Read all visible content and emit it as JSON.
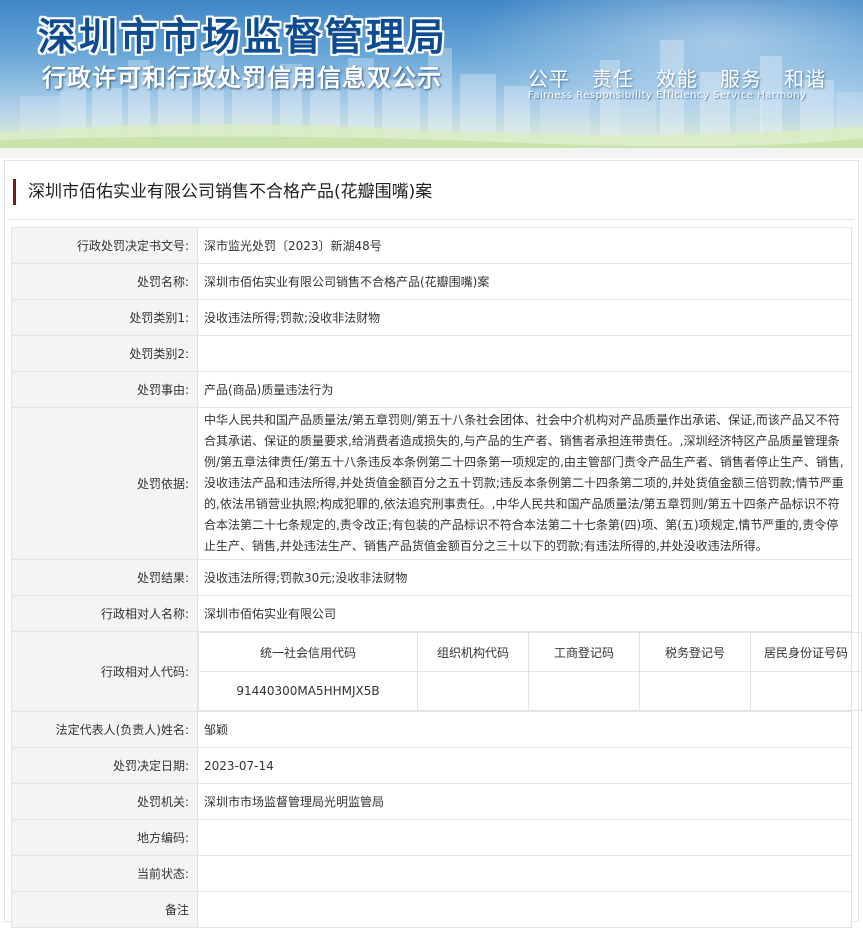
{
  "banner": {
    "title": "深圳市市场监督管理局",
    "subtitle": "行政许可和行政处罚信用信息双公示",
    "slogan": [
      "公平",
      "责任",
      "效能",
      "服务",
      "和谐"
    ],
    "slogan_en": "Fairness Responsibility Efficiency Service Harmony"
  },
  "page": {
    "title": "深圳市佰佑实业有限公司销售不合格产品(花瓣围嘴)案"
  },
  "fields": {
    "doc_no": {
      "label": "行政处罚决定书文号:",
      "value": "深市监光处罚〔2023〕新湖48号"
    },
    "case_name": {
      "label": "处罚名称:",
      "value": "深圳市佰佑实业有限公司销售不合格产品(花瓣围嘴)案"
    },
    "category1": {
      "label": "处罚类别1:",
      "value": "没收违法所得;罚款;没收非法财物"
    },
    "category2": {
      "label": "处罚类别2:",
      "value": ""
    },
    "reason": {
      "label": "处罚事由:",
      "value": "产品(商品)质量违法行为"
    },
    "basis": {
      "label": "处罚依据:",
      "value": "中华人民共和国产品质量法/第五章罚则/第五十八条社会团体、社会中介机构对产品质量作出承诺、保证,而该产品又不符合其承诺、保证的质量要求,给消费者造成损失的,与产品的生产者、销售者承担连带责任。,深圳经济特区产品质量管理条例/第五章法律责任/第五十八条违反本条例第二十四条第一项规定的,由主管部门责令产品生产者、销售者停止生产、销售,没收违法产品和违法所得,并处货值金额百分之五十罚款;违反本条例第二十四条第二项的,并处货值金额三倍罚款;情节严重的,依法吊销营业执照;构成犯罪的,依法追究刑事责任。,中华人民共和国产品质量法/第五章罚则/第五十四条产品标识不符合本法第二十七条规定的,责令改正;有包装的产品标识不符合本法第二十七条第(四)项、第(五)项规定,情节严重的,责令停止生产、销售,并处违法生产、销售产品货值金额百分之三十以下的罚款;有违法所得的,并处没收违法所得。"
    },
    "result": {
      "label": "处罚结果:",
      "value": "没收违法所得;罚款30元;没收非法财物"
    },
    "party_name": {
      "label": "行政相对人名称:",
      "value": "深圳市佰佑实业有限公司"
    },
    "party_code": {
      "label": "行政相对人代码:",
      "headers": [
        "统一社会信用代码",
        "组织机构代码",
        "工商登记码",
        "税务登记号",
        "居民身份证号码"
      ],
      "values": [
        "91440300MA5HHMJX5B",
        "",
        "",
        "",
        ""
      ]
    },
    "legal_rep": {
      "label": "法定代表人(负责人)姓名:",
      "value": "邹颖"
    },
    "decision_date": {
      "label": "处罚决定日期:",
      "value": "2023-07-14"
    },
    "authority": {
      "label": "处罚机关:",
      "value": "深圳市市场监督管理局光明监管局"
    },
    "region_code": {
      "label": "地方编码:",
      "value": ""
    },
    "status": {
      "label": "当前状态:",
      "value": ""
    },
    "remark": {
      "label": "备注",
      "value": ""
    }
  }
}
